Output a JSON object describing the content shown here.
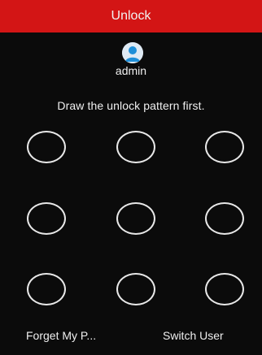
{
  "dialog": {
    "title": "Unlock",
    "title_bar_color": "#d31515",
    "background_color": "#0b0b0b"
  },
  "user": {
    "name": "admin",
    "avatar_icon": "user-avatar-icon"
  },
  "instruction": "Draw the unlock pattern first.",
  "pattern_grid": {
    "rows": 3,
    "columns": 3,
    "dot_outline_color": "#e8e8e8"
  },
  "footer": {
    "forgot_label": "Forget My P...",
    "switch_label": "Switch User"
  }
}
